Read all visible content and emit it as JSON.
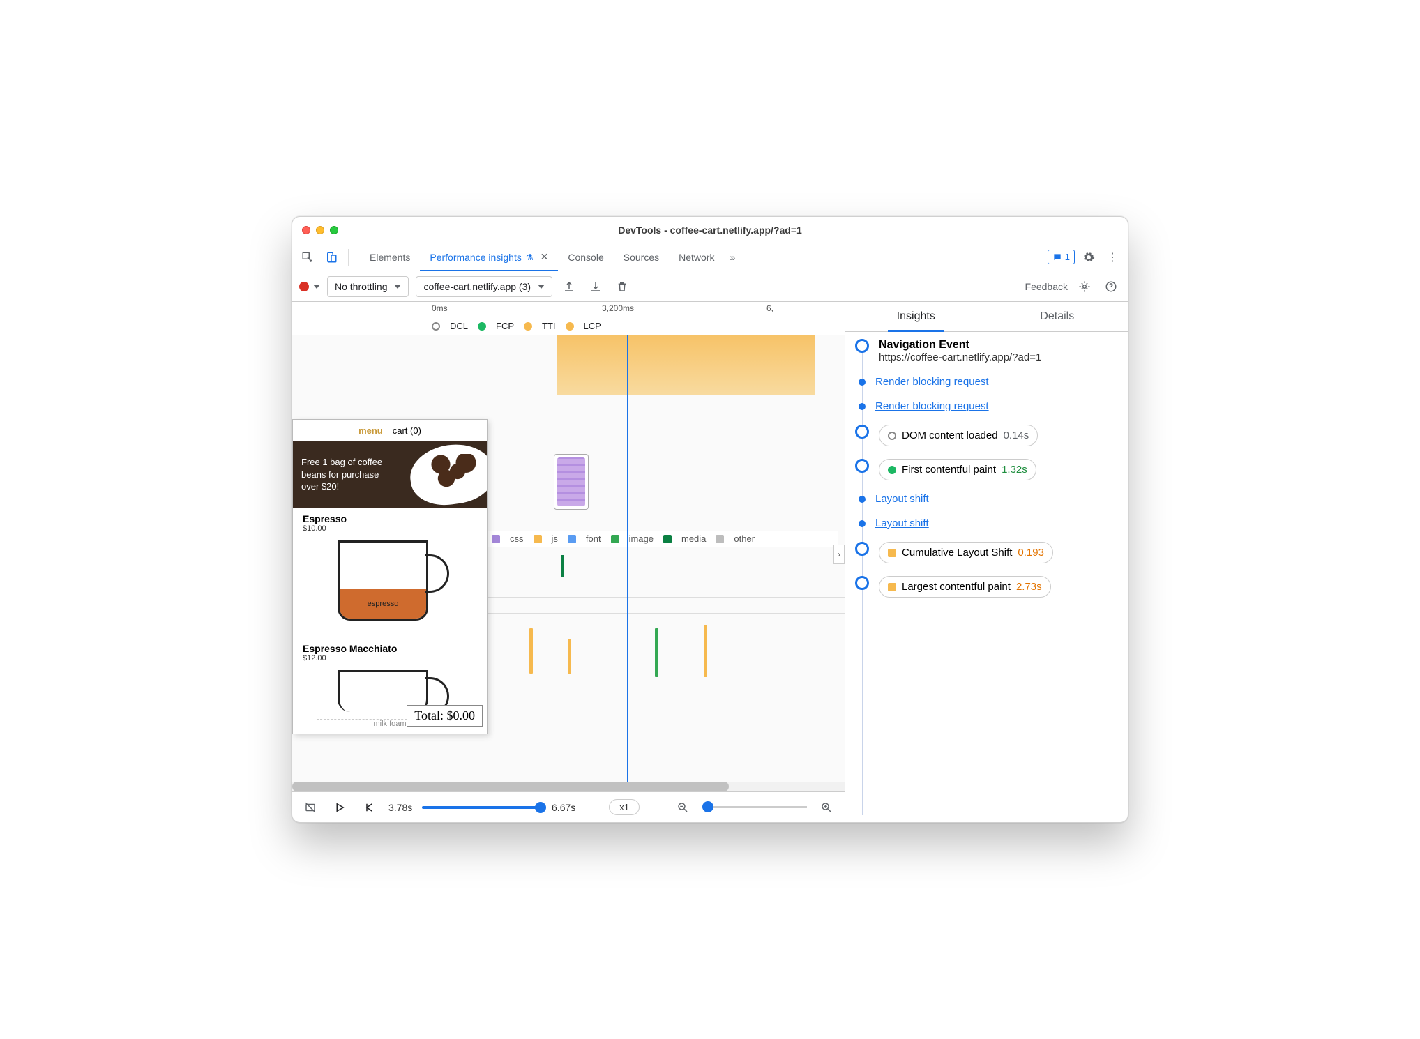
{
  "window": {
    "title": "DevTools - coffee-cart.netlify.app/?ad=1"
  },
  "tabs": {
    "elements": "Elements",
    "perf_insights": "Performance insights",
    "console": "Console",
    "sources": "Sources",
    "network": "Network",
    "chat_count": "1"
  },
  "toolbar": {
    "throttle": "No throttling",
    "session": "coffee-cart.netlify.app (3)",
    "feedback": "Feedback"
  },
  "ruler": {
    "t0": "0ms",
    "t1": "3,200ms",
    "t2": "6,"
  },
  "markers": {
    "dcl": "DCL",
    "fcp": "FCP",
    "tti": "TTI",
    "lcp": "LCP"
  },
  "legend": {
    "css": "css",
    "js": "js",
    "font": "font",
    "image": "image",
    "media": "media",
    "other": "other"
  },
  "preview": {
    "menu": "menu",
    "cart": "cart (0)",
    "banner": "Free 1 bag of coffee beans for purchase over $20!",
    "item1_name": "Espresso",
    "item1_price": "$10.00",
    "item1_fill": "espresso",
    "item2_name": "Espresso Macchiato",
    "item2_price": "$12.00",
    "total": "Total: $0.00",
    "foam": "milk foam"
  },
  "controls": {
    "time_current": "3.78s",
    "time_end": "6.67s",
    "zoom": "x1"
  },
  "right": {
    "tab_insights": "Insights",
    "tab_details": "Details",
    "nav_title": "Navigation Event",
    "nav_url": "https://coffee-cart.netlify.app/?ad=1",
    "rb1": "Render blocking request",
    "rb2": "Render blocking request",
    "dcl_label": "DOM content loaded",
    "dcl_val": "0.14s",
    "fcp_label": "First contentful paint",
    "fcp_val": "1.32s",
    "ls1": "Layout shift",
    "ls2": "Layout shift",
    "cls_label": "Cumulative Layout Shift",
    "cls_val": "0.193",
    "lcp_label": "Largest contentful paint",
    "lcp_val": "2.73s"
  },
  "colors": {
    "css": "#a386d8",
    "js": "#f6b94e",
    "font": "#5a9cf2",
    "image": "#34a853",
    "media": "#0b8043",
    "other": "#bdbdbd",
    "fcp": "#1cb863",
    "tti": "#f6b94e",
    "lcp": "#f6b94e"
  }
}
